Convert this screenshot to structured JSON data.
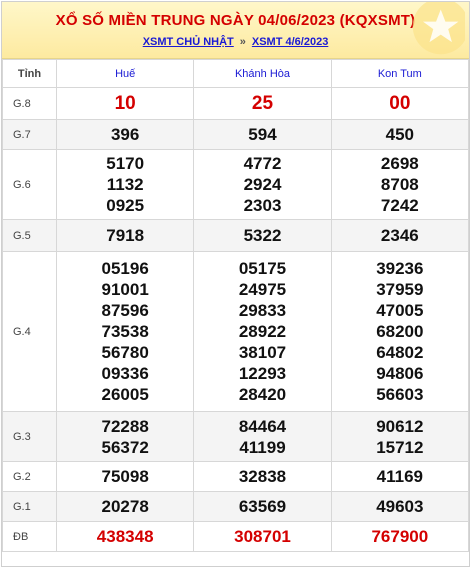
{
  "header": {
    "title": "XỔ SỐ MIỀN TRUNG NGÀY 04/06/2023 (KQXSMT)",
    "link1": "XSMT CHỦ NHẬT",
    "separator": "»",
    "link2": "XSMT 4/6/2023"
  },
  "table": {
    "col_label": "Tỉnh",
    "provinces": [
      "Huế",
      "Khánh Hòa",
      "Kon Tum"
    ],
    "prizes": {
      "g8": {
        "label": "G.8",
        "values": [
          "10",
          "25",
          "00"
        ]
      },
      "g7": {
        "label": "G.7",
        "values": [
          "396",
          "594",
          "450"
        ]
      },
      "g6": {
        "label": "G.6",
        "values": [
          [
            "5170",
            "1132",
            "0925"
          ],
          [
            "4772",
            "2924",
            "2303"
          ],
          [
            "2698",
            "8708",
            "7242"
          ]
        ]
      },
      "g5": {
        "label": "G.5",
        "values": [
          "7918",
          "5322",
          "2346"
        ]
      },
      "g4": {
        "label": "G.4",
        "values": [
          [
            "05196",
            "91001",
            "87596",
            "73538",
            "56780",
            "09336",
            "26005"
          ],
          [
            "05175",
            "24975",
            "29833",
            "28922",
            "38107",
            "12293",
            "28420"
          ],
          [
            "39236",
            "37959",
            "47005",
            "68200",
            "64802",
            "94806",
            "56603"
          ]
        ]
      },
      "g3": {
        "label": "G.3",
        "values": [
          [
            "72288",
            "56372"
          ],
          [
            "84464",
            "41199"
          ],
          [
            "90612",
            "15712"
          ]
        ]
      },
      "g2": {
        "label": "G.2",
        "values": [
          "75098",
          "32838",
          "41169"
        ]
      },
      "g1": {
        "label": "G.1",
        "values": [
          "20278",
          "63569",
          "49603"
        ]
      },
      "db": {
        "label": "ĐB",
        "values": [
          "438348",
          "308701",
          "767900"
        ]
      }
    }
  },
  "colors": {
    "accent_red": "#d40000",
    "link_blue": "#1a1ad4",
    "header_bg": "#fdeaa0"
  },
  "icons": {
    "header_decoration": "star-icon"
  }
}
